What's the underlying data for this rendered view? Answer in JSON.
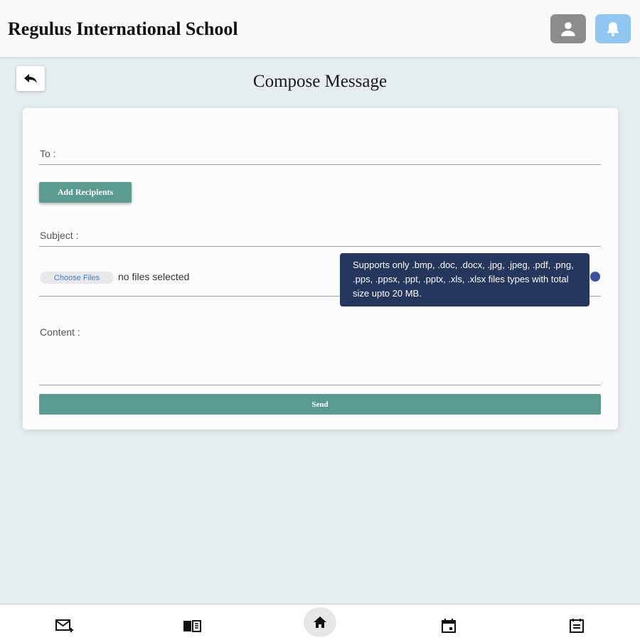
{
  "header": {
    "school_name": "Regulus International School",
    "profile_icon": "user-icon",
    "bell_icon": "bell-icon"
  },
  "page": {
    "title": "Compose Message",
    "back_icon": "back-arrow-icon"
  },
  "form": {
    "to_label": "To :",
    "add_recipients_label": "Add Recipients",
    "subject_label": "Subject :",
    "choose_files_label": "Choose Files",
    "no_files_text": "no files selected",
    "tooltip_text": "Supports only .bmp, .doc, .docx, .jpg, .jpeg, .pdf, .png, .pps, .ppsx, .ppt, .pptx, .xls, .xlsx files types with total size upto 20 MB.",
    "content_label": "Content :",
    "send_label": "Send"
  },
  "nav": {
    "items": [
      {
        "icon": "compose-mail-icon"
      },
      {
        "icon": "book-icon"
      },
      {
        "icon": "home-icon",
        "active": true
      },
      {
        "icon": "calendar-icon"
      },
      {
        "icon": "notes-icon"
      }
    ]
  },
  "colors": {
    "primary": "#5a9b8f",
    "tooltip_bg": "#26375d",
    "bell_bg": "#8fc7f2",
    "profile_bg": "#8c8c8c"
  }
}
